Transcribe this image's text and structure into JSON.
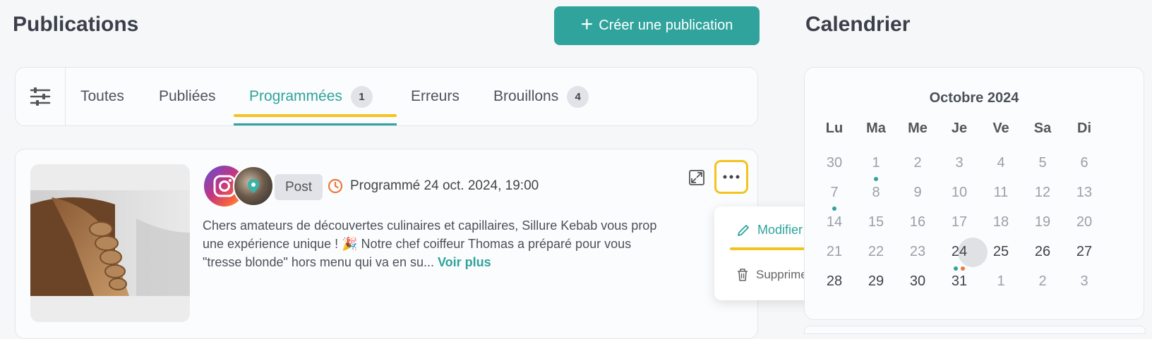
{
  "header": {
    "title": "Publications",
    "create_label": "Créer une publication"
  },
  "calendar_header": {
    "title": "Calendrier"
  },
  "tabs": [
    {
      "label": "Toutes"
    },
    {
      "label": "Publiées"
    },
    {
      "label": "Programmées",
      "count": "1"
    },
    {
      "label": "Erreurs"
    },
    {
      "label": "Brouillons",
      "count": "4"
    }
  ],
  "post": {
    "type": "Post",
    "scheduled": "Programmé 24 oct. 2024, 19:00",
    "caption_lines": [
      "Chers amateurs de découvertes culinaires et capillaires, Sillure Kebab vous prop",
      "une expérience unique ! 🎉  Notre chef coiffeur Thomas a préparé pour vous",
      "\"tresse blonde\" hors menu qui va en su..."
    ],
    "more_link": "Voir plus"
  },
  "menu": {
    "edit": "Modifier",
    "delete": "Supprimer"
  },
  "calendar": {
    "month": "Octobre 2024",
    "weekdays": [
      "Lu",
      "Ma",
      "Me",
      "Je",
      "Ve",
      "Sa",
      "Di"
    ],
    "weeks": [
      [
        "30",
        "1",
        "2",
        "3",
        "4",
        "5",
        "6"
      ],
      [
        "7",
        "8",
        "9",
        "10",
        "11",
        "12",
        "13"
      ],
      [
        "14",
        "15",
        "16",
        "17",
        "18",
        "19",
        "20"
      ],
      [
        "21",
        "22",
        "23",
        "24",
        "25",
        "26",
        "27"
      ],
      [
        "28",
        "29",
        "30",
        "31",
        "1",
        "2",
        "3"
      ]
    ],
    "today": "24"
  },
  "colors": {
    "accent": "#2fa39c",
    "highlight": "#f5c31d",
    "dot_orange": "#f0783c"
  }
}
